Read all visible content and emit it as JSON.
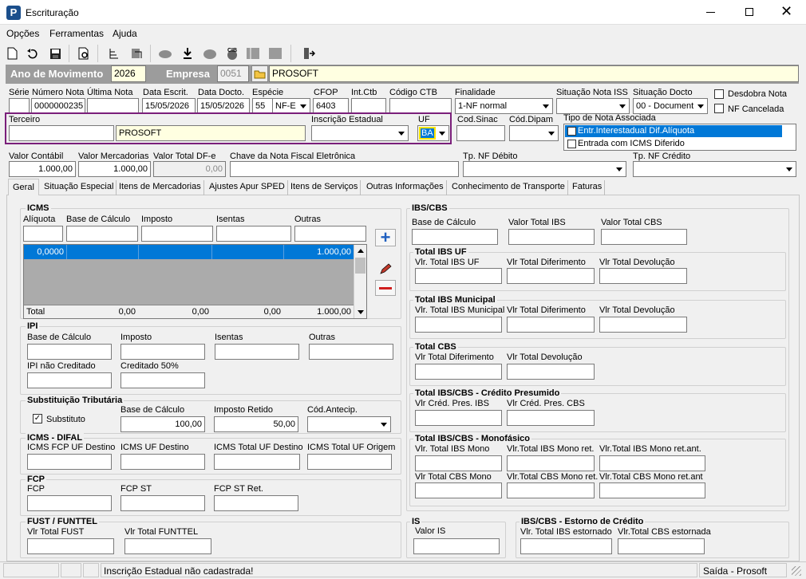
{
  "window": {
    "title": "Escrituração"
  },
  "menu": [
    "Opções",
    "Ferramentas",
    "Ajuda"
  ],
  "toolbar_icons": [
    "new-doc-icon",
    "undo-icon",
    "save-icon",
    "preview-icon",
    "tree-icon",
    "tools-icon",
    "cloud-icon",
    "import-icon",
    "cloud-down-icon",
    "cib-icon",
    "grid-icon",
    "square-icon",
    "exit-icon"
  ],
  "header": {
    "ano_label": "Ano de Movimento",
    "ano": "2026",
    "empresa_label": "Empresa",
    "empresa_code": "0051",
    "empresa_name": "PROSOFT"
  },
  "row1": {
    "serie": "Série",
    "numero": "Número Nota",
    "numero_val": "0000000235",
    "ultima": "Última Nota",
    "data_escrit": "Data Escrit.",
    "data_escrit_val": "15/05/2026",
    "data_docto": "Data Docto.",
    "data_docto_val": "15/05/2026",
    "especie": "Espécie",
    "especie_num": "55",
    "especie_val": "NF-E",
    "cfop": "CFOP",
    "cfop_val": "6403",
    "intctb": "Int.Ctb",
    "codctb": "Código CTB",
    "finalidade": "Finalidade",
    "finalidade_val": "1-NF normal",
    "sit_iss": "Situação Nota ISS",
    "sit_docto": "Situação Docto",
    "sit_docto_val": "00 - Document",
    "desdobra": "Desdobra Nota",
    "cancelada": "NF Cancelada"
  },
  "row2": {
    "terceiro": "Terceiro",
    "terceiro_name": "PROSOFT",
    "ie": "Inscrição Estadual",
    "uf": "UF",
    "uf_val": "BA",
    "sinac": "Cod.Sinac",
    "dipam": "Cód.Dipam",
    "tipo": "Tipo de Nota Associada",
    "tipo_opts": [
      "Entr.Interestadual Dif.Alíquota",
      "Entrada com ICMS Diferido"
    ]
  },
  "row3": {
    "vc": "Valor Contábil",
    "vc_val": "1.000,00",
    "vm": "Valor Mercadorias",
    "vm_val": "1.000,00",
    "vt": "Valor Total DF-e",
    "vt_val": "0,00",
    "chave": "Chave da Nota Fiscal Eletrônica",
    "tpdeb": "Tp. NF Débito",
    "tpcred": "Tp. NF Crédito"
  },
  "tabs": [
    "Geral",
    "Situação Especial",
    "Itens de Mercadorias",
    "Ajustes Apur SPED",
    "Itens de Serviços",
    "Outras Informações",
    "Conhecimento de Transporte",
    "Faturas"
  ],
  "icms": {
    "title": "ICMS",
    "cols": [
      "Alíquota",
      "Base de Cálculo",
      "Imposto",
      "Isentas",
      "Outras"
    ],
    "row": [
      "0,0000",
      "",
      "",
      "",
      "1.000,00"
    ],
    "total": [
      "Total",
      "0,00",
      "0,00",
      "0,00",
      "1.000,00"
    ]
  },
  "ipi": {
    "title": "IPI",
    "f": [
      "Base de Cálculo",
      "Imposto",
      "Isentas",
      "Outras",
      "IPI não Creditado",
      "Creditado 50%"
    ]
  },
  "st": {
    "title": "Substituição Tributária",
    "substituto": "Substituto",
    "base": "Base de Cálculo",
    "base_val": "100,00",
    "imp": "Imposto Retido",
    "imp_val": "50,00",
    "cod": "Cód.Antecip."
  },
  "difal": {
    "title": "ICMS - DIFAL",
    "f": [
      "ICMS FCP UF Destino",
      "ICMS UF Destino",
      "ICMS Total UF Destino",
      "ICMS Total UF Origem"
    ]
  },
  "fcp": {
    "title": "FCP",
    "f": [
      "FCP",
      "FCP ST",
      "FCP ST Ret."
    ]
  },
  "fust": {
    "title": "FUST / FUNTTEL",
    "f": [
      "Vlr Total FUST",
      "Vlr Total FUNTTEL"
    ]
  },
  "ibscbs": {
    "title": "IBS/CBS",
    "f": [
      "Base de Cálculo",
      "Valor Total IBS",
      "Valor Total CBS"
    ]
  },
  "ibsuf": {
    "title": "Total IBS UF",
    "f": [
      "Vlr. Total IBS UF",
      "Vlr Total Diferimento",
      "Vlr Total Devolução"
    ]
  },
  "ibsmun": {
    "title": "Total IBS Municipal",
    "f": [
      "Vlr. Total IBS Municipal",
      "Vlr Total Diferimento",
      "Vlr Total Devolução"
    ]
  },
  "cbs": {
    "title": "Total CBS",
    "f": [
      "Vlr Total Diferimento",
      "Vlr Total Devolução"
    ]
  },
  "presumido": {
    "title": "Total IBS/CBS - Crédito Presumido",
    "f": [
      "Vlr Créd. Pres. IBS",
      "Vlr Créd. Pres. CBS"
    ]
  },
  "mono": {
    "title": "Total IBS/CBS - Monofásico",
    "f": [
      "Vlr. Total IBS Mono",
      "Vlr.Total IBS Mono ret.",
      "Vlr.Total IBS Mono ret.ant.",
      "Vlr Total CBS Mono",
      "Vlr.Total CBS Mono ret.",
      "Vlr.Total CBS Mono ret.ant"
    ]
  },
  "is": {
    "title": "IS",
    "f": [
      "Valor IS"
    ]
  },
  "estorno": {
    "title": "IBS/CBS - Estorno de Crédito",
    "f": [
      "Vlr. Total IBS estornado",
      "Vlr.Total CBS estornada"
    ]
  },
  "status": {
    "msg": "Inscrição Estadual não cadastrada!",
    "right": "Saída - Prosoft"
  },
  "colors": {
    "accent": "#0078d7",
    "header_bg": "#9c9c9c",
    "highlight": "#7a1f7a"
  }
}
